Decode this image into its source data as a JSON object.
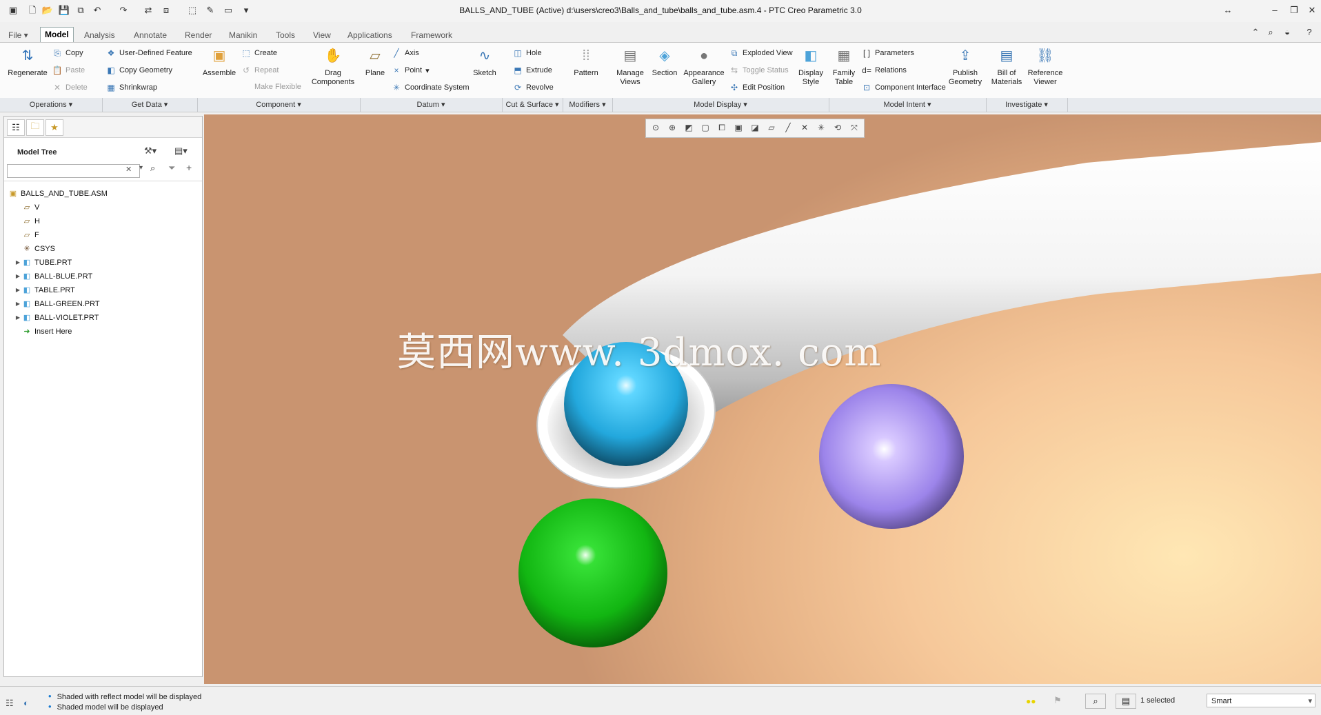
{
  "window": {
    "title": "BALLS_AND_TUBE (Active) d:\\users\\creo3\\Balls_and_tube\\balls_and_tube.asm.4 - PTC Creo Parametric 3.0"
  },
  "tabs": [
    {
      "label": "File ▾"
    },
    {
      "label": "Model"
    },
    {
      "label": "Analysis"
    },
    {
      "label": "Annotate"
    },
    {
      "label": "Render"
    },
    {
      "label": "Manikin"
    },
    {
      "label": "Tools"
    },
    {
      "label": "View"
    },
    {
      "label": "Applications"
    },
    {
      "label": "Framework"
    }
  ],
  "ribbon": {
    "regenerate": "Regenerate",
    "copy": "Copy",
    "paste": "Paste",
    "delete": "Delete",
    "udf": "User-Defined Feature",
    "copy_geometry": "Copy Geometry",
    "shrinkwrap": "Shrinkwrap",
    "assemble": "Assemble",
    "create": "Create",
    "repeat": "Repeat",
    "make_flexible": "Make Flexible",
    "drag_components": "Drag Components",
    "plane": "Plane",
    "axis": "Axis",
    "point": "Point",
    "coordinate_system": "Coordinate System",
    "sketch": "Sketch",
    "hole": "Hole",
    "extrude": "Extrude",
    "revolve": "Revolve",
    "pattern": "Pattern",
    "manage_views": "Manage Views",
    "section": "Section",
    "appearance_gallery": "Appearance Gallery",
    "exploded_view": "Exploded View",
    "toggle_status": "Toggle Status",
    "edit_position": "Edit Position",
    "display_style": "Display Style",
    "family_table": "Family Table",
    "parameters": "Parameters",
    "relations": "Relations",
    "component_interface": "Component Interface",
    "publish_geometry": "Publish Geometry",
    "bill_of_materials": "Bill of Materials",
    "reference_viewer": "Reference Viewer"
  },
  "groups": [
    {
      "label": "Operations ▾"
    },
    {
      "label": "Get Data ▾"
    },
    {
      "label": "Component ▾"
    },
    {
      "label": "Datum ▾"
    },
    {
      "label": "Cut & Surface ▾"
    },
    {
      "label": "Modifiers ▾"
    },
    {
      "label": "Model Display ▾"
    },
    {
      "label": "Model Intent ▾"
    },
    {
      "label": "Investigate ▾"
    }
  ],
  "model_tree": {
    "title": "Model Tree",
    "search_value": "",
    "items": [
      {
        "label": "BALLS_AND_TUBE.ASM",
        "icon": "assembly-icon"
      },
      {
        "label": "V",
        "icon": "datum-plane-icon"
      },
      {
        "label": "H",
        "icon": "datum-plane-icon"
      },
      {
        "label": "F",
        "icon": "datum-plane-icon"
      },
      {
        "label": "CSYS",
        "icon": "csys-icon"
      },
      {
        "label": "TUBE.PRT",
        "icon": "part-icon"
      },
      {
        "label": "BALL-BLUE.PRT",
        "icon": "part-icon"
      },
      {
        "label": "TABLE.PRT",
        "icon": "part-icon"
      },
      {
        "label": "BALL-GREEN.PRT",
        "icon": "part-icon"
      },
      {
        "label": "BALL-VIOLET.PRT",
        "icon": "part-icon"
      },
      {
        "label": "Insert Here",
        "icon": "insert-arrow-icon"
      }
    ]
  },
  "viewport": {
    "watermark": "莫西网www. 3dmox. com",
    "colors": {
      "blue_ball": "#2fc0f0",
      "green_ball": "#16c416",
      "violet_ball": "#a98cf0",
      "tube": "#f2f2f2"
    }
  },
  "status": {
    "messages": [
      "Shaded with reflect model will be displayed",
      "Shaded model will be displayed"
    ],
    "selected": "1 selected",
    "filter": "Smart"
  }
}
